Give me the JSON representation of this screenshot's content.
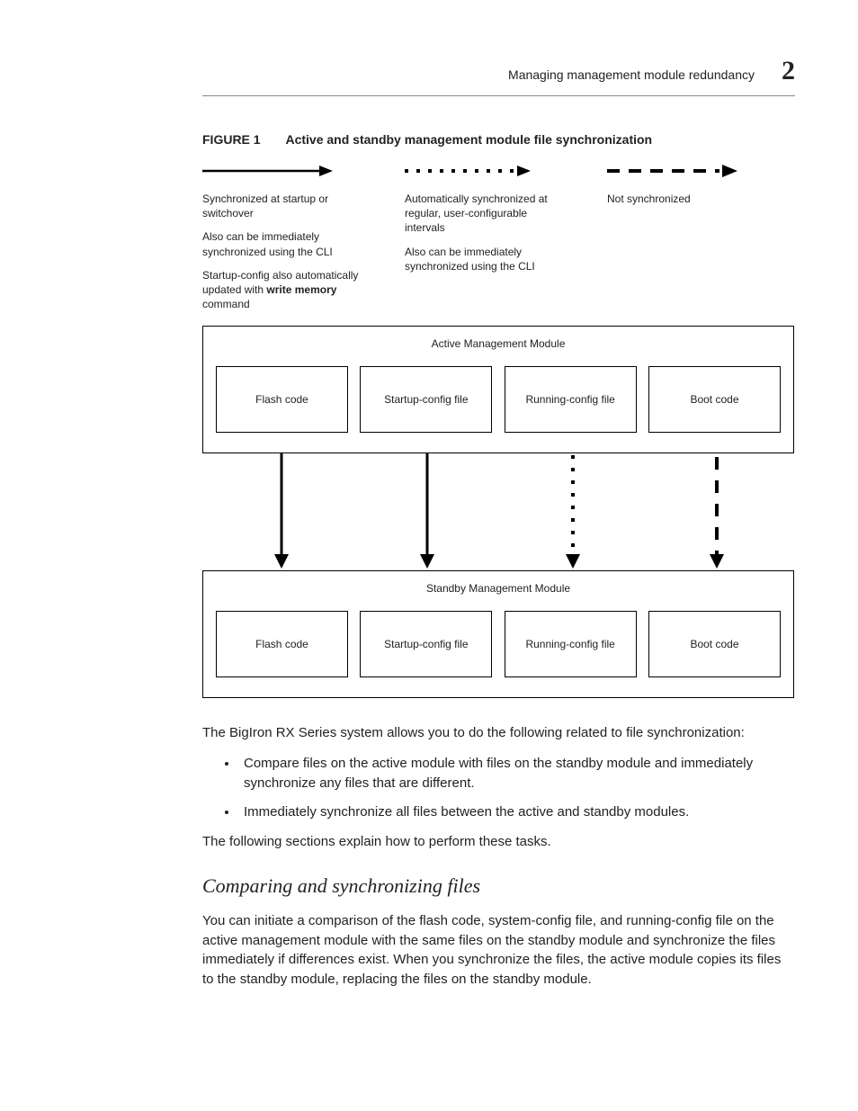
{
  "header": {
    "title": "Managing management module redundancy",
    "chapter": "2"
  },
  "figure": {
    "label": "FIGURE 1",
    "caption": "Active and standby management module file synchronization"
  },
  "legend": {
    "col1": {
      "line1": "Synchronized at startup or switchover",
      "line2": "Also can be immediately synchronized using the CLI",
      "line3a": "Startup-config also automatically updated with ",
      "line3bold": "write memory",
      "line3b": " command"
    },
    "col2": {
      "line1": "Automatically synchronized at regular, user-configurable intervals",
      "line2": "Also can be immediately synchronized using the CLI"
    },
    "col3": {
      "line1": "Not synchronized"
    }
  },
  "diagram": {
    "active_title": "Active Management Module",
    "standby_title": "Standby Management Module",
    "boxes": [
      "Flash code",
      "Startup-config file",
      "Running-config file",
      "Boot code"
    ]
  },
  "body": {
    "intro": "The BigIron RX Series system allows you to do the following related to file synchronization:",
    "bullet1": "Compare files on the active module with files on the standby module and immediately synchronize any files that are different.",
    "bullet2": "Immediately synchronize all files between the active and standby modules.",
    "follow": "The following sections explain how to perform these tasks.",
    "subhead": "Comparing and synchronizing files",
    "para2": "You can initiate a comparison of the flash code, system-config file, and running-config file on the active management module with the same files on the standby module and synchronize the files immediately if differences exist. When you synchronize the files, the active module copies its files to the standby module, replacing the files on the standby module."
  }
}
